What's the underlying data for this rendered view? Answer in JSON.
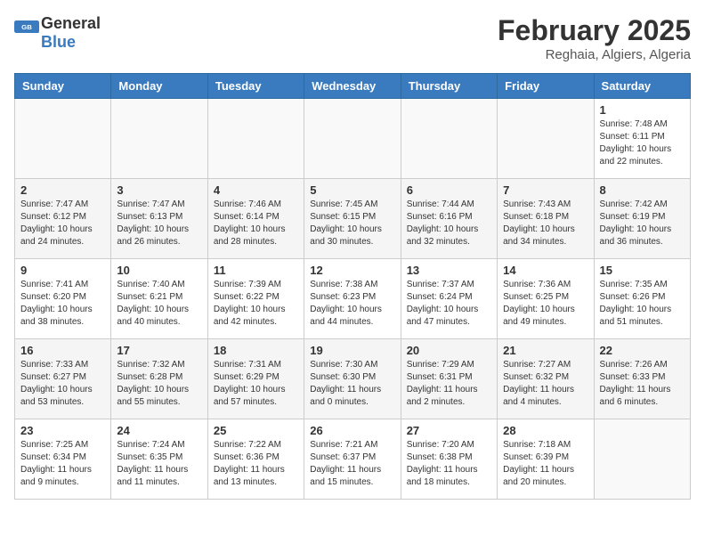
{
  "header": {
    "logo_general": "General",
    "logo_blue": "Blue",
    "month": "February 2025",
    "location": "Reghaia, Algiers, Algeria"
  },
  "weekdays": [
    "Sunday",
    "Monday",
    "Tuesday",
    "Wednesday",
    "Thursday",
    "Friday",
    "Saturday"
  ],
  "weeks": [
    [
      {
        "day": "",
        "info": ""
      },
      {
        "day": "",
        "info": ""
      },
      {
        "day": "",
        "info": ""
      },
      {
        "day": "",
        "info": ""
      },
      {
        "day": "",
        "info": ""
      },
      {
        "day": "",
        "info": ""
      },
      {
        "day": "1",
        "info": "Sunrise: 7:48 AM\nSunset: 6:11 PM\nDaylight: 10 hours and 22 minutes."
      }
    ],
    [
      {
        "day": "2",
        "info": "Sunrise: 7:47 AM\nSunset: 6:12 PM\nDaylight: 10 hours and 24 minutes."
      },
      {
        "day": "3",
        "info": "Sunrise: 7:47 AM\nSunset: 6:13 PM\nDaylight: 10 hours and 26 minutes."
      },
      {
        "day": "4",
        "info": "Sunrise: 7:46 AM\nSunset: 6:14 PM\nDaylight: 10 hours and 28 minutes."
      },
      {
        "day": "5",
        "info": "Sunrise: 7:45 AM\nSunset: 6:15 PM\nDaylight: 10 hours and 30 minutes."
      },
      {
        "day": "6",
        "info": "Sunrise: 7:44 AM\nSunset: 6:16 PM\nDaylight: 10 hours and 32 minutes."
      },
      {
        "day": "7",
        "info": "Sunrise: 7:43 AM\nSunset: 6:18 PM\nDaylight: 10 hours and 34 minutes."
      },
      {
        "day": "8",
        "info": "Sunrise: 7:42 AM\nSunset: 6:19 PM\nDaylight: 10 hours and 36 minutes."
      }
    ],
    [
      {
        "day": "9",
        "info": "Sunrise: 7:41 AM\nSunset: 6:20 PM\nDaylight: 10 hours and 38 minutes."
      },
      {
        "day": "10",
        "info": "Sunrise: 7:40 AM\nSunset: 6:21 PM\nDaylight: 10 hours and 40 minutes."
      },
      {
        "day": "11",
        "info": "Sunrise: 7:39 AM\nSunset: 6:22 PM\nDaylight: 10 hours and 42 minutes."
      },
      {
        "day": "12",
        "info": "Sunrise: 7:38 AM\nSunset: 6:23 PM\nDaylight: 10 hours and 44 minutes."
      },
      {
        "day": "13",
        "info": "Sunrise: 7:37 AM\nSunset: 6:24 PM\nDaylight: 10 hours and 47 minutes."
      },
      {
        "day": "14",
        "info": "Sunrise: 7:36 AM\nSunset: 6:25 PM\nDaylight: 10 hours and 49 minutes."
      },
      {
        "day": "15",
        "info": "Sunrise: 7:35 AM\nSunset: 6:26 PM\nDaylight: 10 hours and 51 minutes."
      }
    ],
    [
      {
        "day": "16",
        "info": "Sunrise: 7:33 AM\nSunset: 6:27 PM\nDaylight: 10 hours and 53 minutes."
      },
      {
        "day": "17",
        "info": "Sunrise: 7:32 AM\nSunset: 6:28 PM\nDaylight: 10 hours and 55 minutes."
      },
      {
        "day": "18",
        "info": "Sunrise: 7:31 AM\nSunset: 6:29 PM\nDaylight: 10 hours and 57 minutes."
      },
      {
        "day": "19",
        "info": "Sunrise: 7:30 AM\nSunset: 6:30 PM\nDaylight: 11 hours and 0 minutes."
      },
      {
        "day": "20",
        "info": "Sunrise: 7:29 AM\nSunset: 6:31 PM\nDaylight: 11 hours and 2 minutes."
      },
      {
        "day": "21",
        "info": "Sunrise: 7:27 AM\nSunset: 6:32 PM\nDaylight: 11 hours and 4 minutes."
      },
      {
        "day": "22",
        "info": "Sunrise: 7:26 AM\nSunset: 6:33 PM\nDaylight: 11 hours and 6 minutes."
      }
    ],
    [
      {
        "day": "23",
        "info": "Sunrise: 7:25 AM\nSunset: 6:34 PM\nDaylight: 11 hours and 9 minutes."
      },
      {
        "day": "24",
        "info": "Sunrise: 7:24 AM\nSunset: 6:35 PM\nDaylight: 11 hours and 11 minutes."
      },
      {
        "day": "25",
        "info": "Sunrise: 7:22 AM\nSunset: 6:36 PM\nDaylight: 11 hours and 13 minutes."
      },
      {
        "day": "26",
        "info": "Sunrise: 7:21 AM\nSunset: 6:37 PM\nDaylight: 11 hours and 15 minutes."
      },
      {
        "day": "27",
        "info": "Sunrise: 7:20 AM\nSunset: 6:38 PM\nDaylight: 11 hours and 18 minutes."
      },
      {
        "day": "28",
        "info": "Sunrise: 7:18 AM\nSunset: 6:39 PM\nDaylight: 11 hours and 20 minutes."
      },
      {
        "day": "",
        "info": ""
      }
    ]
  ]
}
